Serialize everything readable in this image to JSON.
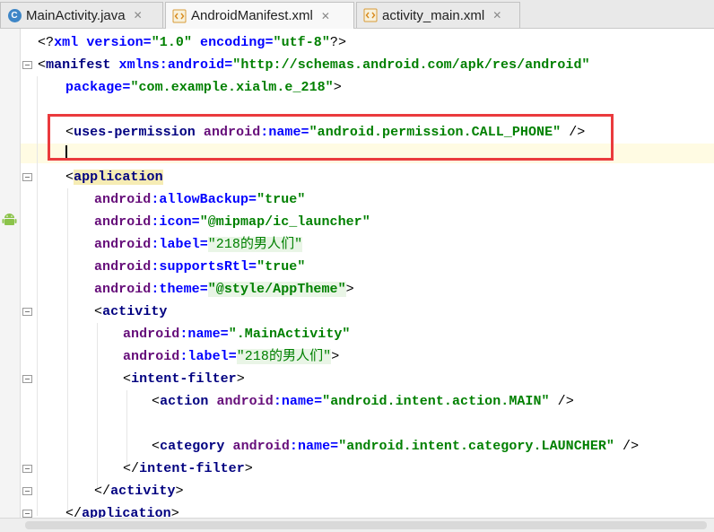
{
  "tabs": [
    {
      "label": "MainActivity.java",
      "icon": "java-class-icon",
      "active": false
    },
    {
      "label": "AndroidManifest.xml",
      "icon": "xml-file-icon",
      "active": true
    },
    {
      "label": "activity_main.xml",
      "icon": "xml-file-icon",
      "active": false
    }
  ],
  "code": {
    "line1": {
      "a": "<?",
      "b": "xml version=",
      "c": "\"1.0\"",
      "d": " encoding=",
      "e": "\"utf-8\"",
      "f": "?>"
    },
    "line2": {
      "a": "<",
      "b": "manifest ",
      "c": "xmlns:",
      "d": "android",
      "e": "=",
      "f": "\"http://schemas.android.com/apk/res/android\""
    },
    "line3": {
      "a": "package",
      "b": "=",
      "c": "\"com.example.xialm.e_218\"",
      "d": ">"
    },
    "line5": {
      "a": "<",
      "b": "uses-permission ",
      "c": "android",
      "d": ":name",
      "e": "=",
      "f": "\"android.permission.CALL_PHONE\"",
      "g": " />"
    },
    "line7": {
      "a": "<",
      "b": "application"
    },
    "line8": {
      "a": "android",
      "b": ":allowBackup",
      "c": "=",
      "d": "\"true\""
    },
    "line9": {
      "a": "android",
      "b": ":icon",
      "c": "=",
      "d": "\"@mipmap/ic_launcher\""
    },
    "line10": {
      "a": "android",
      "b": ":label",
      "c": "=",
      "d": "\"218的男人们\""
    },
    "line11": {
      "a": "android",
      "b": ":supportsRtl",
      "c": "=",
      "d": "\"true\""
    },
    "line12": {
      "a": "android",
      "b": ":theme",
      "c": "=",
      "d": "\"@style/AppTheme\"",
      "e": ">"
    },
    "line13": {
      "a": "<",
      "b": "activity"
    },
    "line14": {
      "a": "android",
      "b": ":name",
      "c": "=",
      "d": "\".MainActivity\""
    },
    "line15": {
      "a": "android",
      "b": ":label",
      "c": "=",
      "d": "\"218的男人们\"",
      "e": ">"
    },
    "line16": {
      "a": "<",
      "b": "intent-filter",
      "c": ">"
    },
    "line17": {
      "a": "<",
      "b": "action ",
      "c": "android",
      "d": ":name",
      "e": "=",
      "f": "\"android.intent.action.MAIN\"",
      "g": " />"
    },
    "line19": {
      "a": "<",
      "b": "category ",
      "c": "android",
      "d": ":name",
      "e": "=",
      "f": "\"android.intent.category.LAUNCHER\"",
      "g": " />"
    },
    "line20": {
      "a": "</",
      "b": "intent-filter",
      "c": ">"
    },
    "line21": {
      "a": "</",
      "b": "activity",
      "c": ">"
    },
    "line22": {
      "a": "</",
      "b": "application",
      "c": ">"
    }
  },
  "colors": {
    "highlight_box": "#ea3a3d",
    "tag": "#000080",
    "namespace": "#660e7a",
    "attribute": "#0000ff",
    "value": "#008000"
  }
}
